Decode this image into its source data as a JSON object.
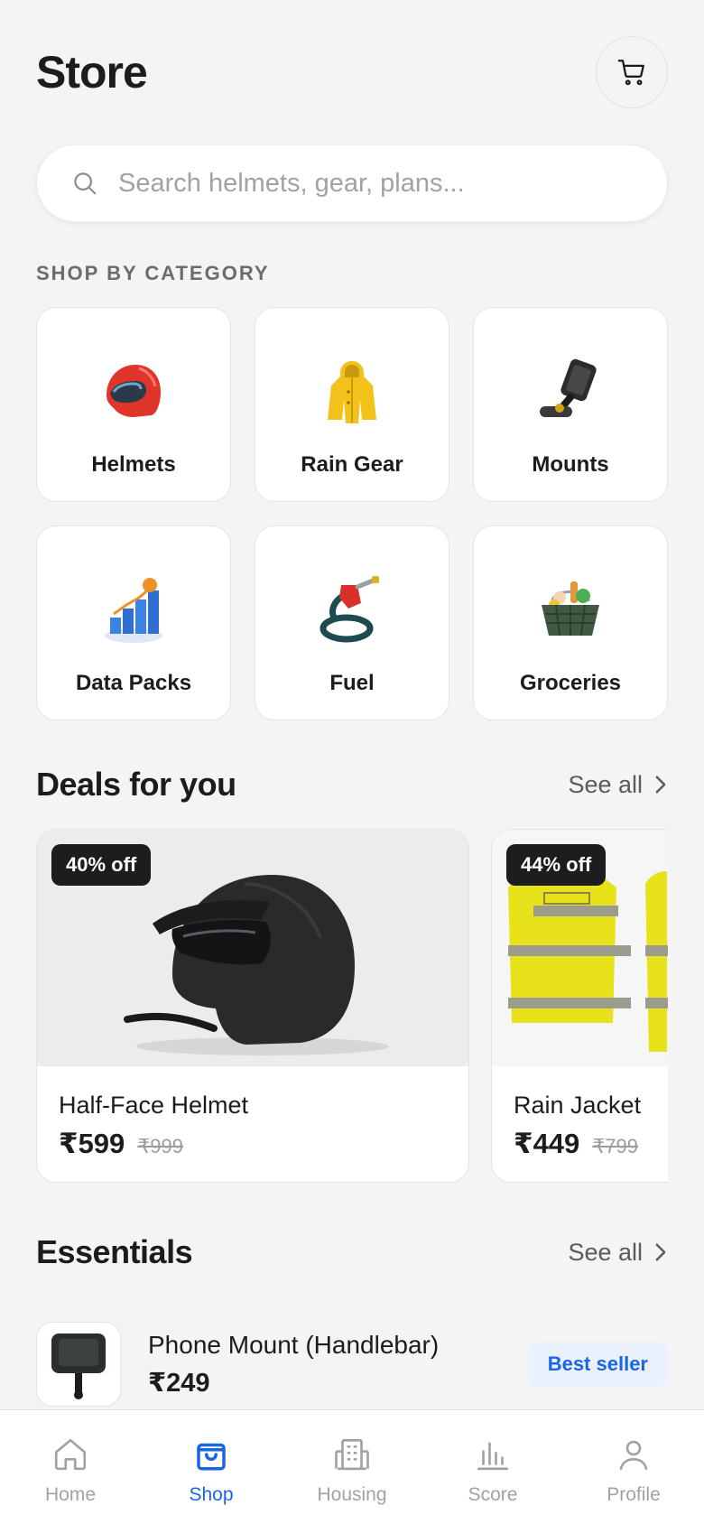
{
  "header": {
    "title": "Store"
  },
  "search": {
    "placeholder": "Search helmets, gear, plans..."
  },
  "categories": {
    "heading": "SHOP BY CATEGORY",
    "items": [
      {
        "label": "Helmets",
        "icon": "helmet-icon"
      },
      {
        "label": "Rain Gear",
        "icon": "raincoat-icon"
      },
      {
        "label": "Mounts",
        "icon": "phone-mount-icon"
      },
      {
        "label": "Data Packs",
        "icon": "data-chart-icon"
      },
      {
        "label": "Fuel",
        "icon": "fuel-pump-icon"
      },
      {
        "label": "Groceries",
        "icon": "grocery-basket-icon"
      }
    ]
  },
  "deals": {
    "title": "Deals for you",
    "see_all": "See all",
    "items": [
      {
        "badge": "40% off",
        "name": "Half-Face Helmet",
        "price": "₹599",
        "old_price": "₹999"
      },
      {
        "badge": "44% off",
        "name": "Rain Jacket",
        "price": "₹449",
        "old_price": "₹799"
      }
    ]
  },
  "essentials": {
    "title": "Essentials",
    "see_all": "See all",
    "items": [
      {
        "name": "Phone Mount (Handlebar)",
        "price": "₹249",
        "badge": "Best seller"
      }
    ]
  },
  "tabs": [
    {
      "label": "Home",
      "icon": "home-icon",
      "active": false
    },
    {
      "label": "Shop",
      "icon": "shopping-bag-icon",
      "active": true
    },
    {
      "label": "Housing",
      "icon": "building-icon",
      "active": false
    },
    {
      "label": "Score",
      "icon": "bar-chart-icon",
      "active": false
    },
    {
      "label": "Profile",
      "icon": "user-icon",
      "active": false
    }
  ],
  "colors": {
    "accent": "#1a66e0",
    "background": "#f4f4f5",
    "badge_bg": "#1d1d1f"
  }
}
